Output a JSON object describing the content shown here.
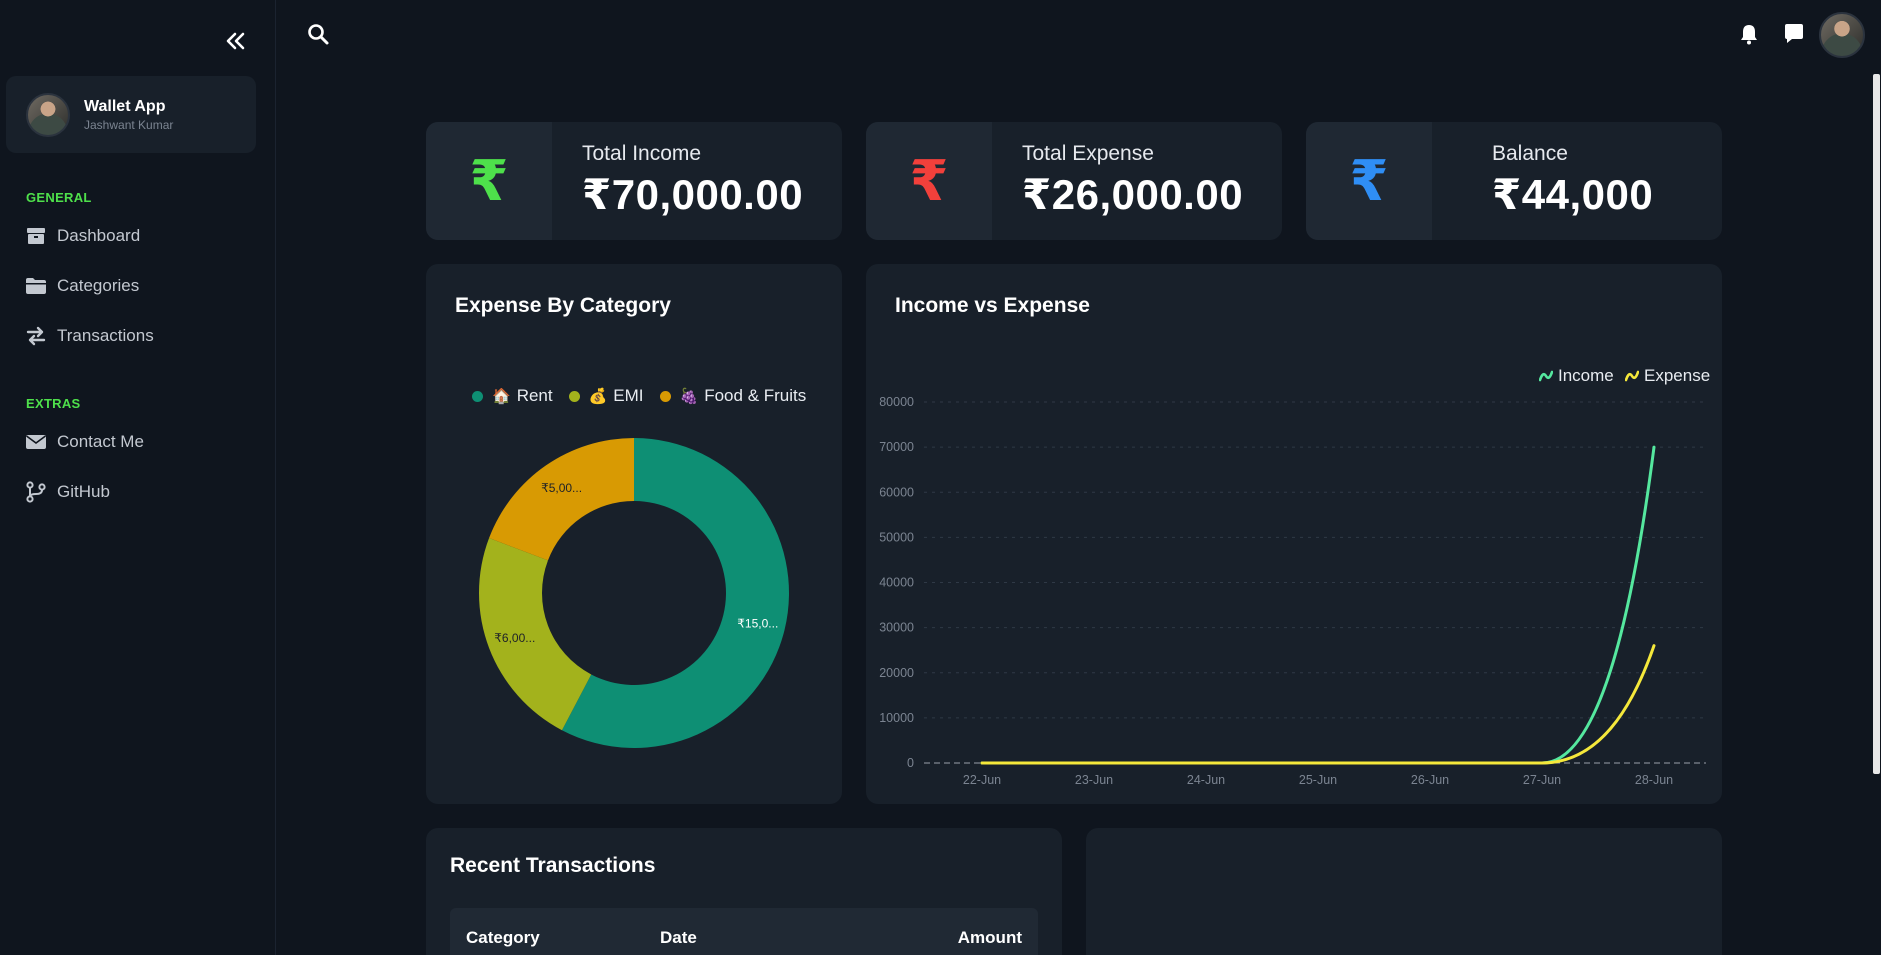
{
  "sidebar": {
    "profile": {
      "name": "Wallet App",
      "subtitle": "Jashwant Kumar"
    },
    "sections": [
      {
        "label": "GENERAL",
        "items": [
          {
            "label": "Dashboard"
          },
          {
            "label": "Categories"
          },
          {
            "label": "Transactions"
          }
        ]
      },
      {
        "label": "EXTRAS",
        "items": [
          {
            "label": "Contact Me"
          },
          {
            "label": "GitHub"
          }
        ]
      }
    ],
    "accent_color": "#4ee04b"
  },
  "stats": [
    {
      "label": "Total Income",
      "value": "₹70,000.00",
      "symbol": "₹",
      "color": "#4ee04b"
    },
    {
      "label": "Total Expense",
      "value": "₹26,000.00",
      "symbol": "₹",
      "color": "#f2403b"
    },
    {
      "label": "Balance",
      "value": "₹44,000",
      "symbol": "₹",
      "color": "#2f8ef5"
    }
  ],
  "expense_panel": {
    "title": "Expense By Category",
    "legend": [
      {
        "emoji": "🏠",
        "label": "Rent",
        "color": "#0e8f74"
      },
      {
        "emoji": "💰",
        "label": "EMI",
        "color": "#a3b21c"
      },
      {
        "emoji": "🍇",
        "label": "Food & Fruits",
        "color": "#d89a03"
      }
    ],
    "slice_labels": [
      "₹15,0...",
      "₹6,00...",
      "₹5,00..."
    ]
  },
  "line_panel": {
    "title": "Income vs Expense",
    "legend": [
      {
        "label": "Income",
        "color": "#55e89f"
      },
      {
        "label": "Expense",
        "color": "#f5e83b"
      }
    ]
  },
  "chart_data": [
    {
      "type": "pie",
      "title": "Expense By Category",
      "categories": [
        "Rent",
        "EMI",
        "Food & Fruits"
      ],
      "values": [
        15000,
        6000,
        5000
      ],
      "colors": [
        "#0e8f74",
        "#a3b21c",
        "#d89a03"
      ],
      "legend": "top"
    },
    {
      "type": "line",
      "title": "Income vs Expense",
      "categories": [
        "22-Jun",
        "23-Jun",
        "24-Jun",
        "25-Jun",
        "26-Jun",
        "27-Jun",
        "28-Jun"
      ],
      "y_ticks": [
        0,
        10000,
        20000,
        30000,
        40000,
        50000,
        60000,
        70000,
        80000
      ],
      "ylim": [
        0,
        80000
      ],
      "series": [
        {
          "name": "Income",
          "values": [
            0,
            0,
            0,
            0,
            0,
            0,
            70000
          ],
          "color": "#55e89f"
        },
        {
          "name": "Expense",
          "values": [
            0,
            0,
            0,
            0,
            0,
            0,
            26000
          ],
          "color": "#f5e83b"
        }
      ],
      "grid": true,
      "legend": "top-right"
    }
  ],
  "transactions": {
    "title": "Recent Transactions",
    "columns": [
      "Category",
      "Date",
      "Amount"
    ]
  }
}
